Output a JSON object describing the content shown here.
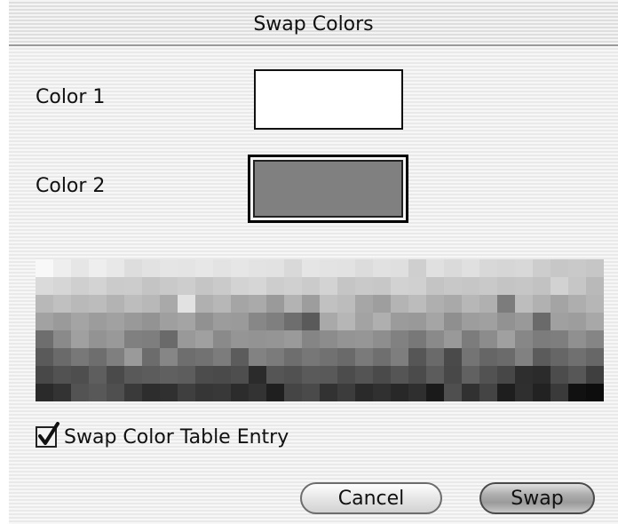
{
  "dialog": {
    "title": "Swap Colors",
    "color1_label": "Color 1",
    "color2_label": "Color 2",
    "color1_value": "#ffffff",
    "color2_value": "#808080",
    "checkbox_label": "Swap Color Table Entry",
    "checkbox_checked": true,
    "cancel_label": "Cancel",
    "swap_label": "Swap"
  },
  "palette": {
    "columns": 32,
    "rows": 8,
    "colors": [
      "#f8f8f8",
      "#eeeeee",
      "#e6e6e6",
      "#eeeeee",
      "#e8e8e8",
      "#dddddd",
      "#e2e2e2",
      "#e5e5e5",
      "#e4e4e4",
      "#e7e7e7",
      "#e3e3e3",
      "#e6e6e6",
      "#e3e3e3",
      "#e2e2e2",
      "#d9d9d9",
      "#e5e5e5",
      "#e3e3e3",
      "#e2e2e2",
      "#dcdcdc",
      "#e1e1e1",
      "#dfdfdf",
      "#cfcfcf",
      "#e0e0e0",
      "#dadada",
      "#e0e0e0",
      "#d8d8d8",
      "#d6d6d6",
      "#d8d8d8",
      "#cdcdcd",
      "#c7c7c7",
      "#c9c9c9",
      "#c6c6c6",
      "#dadada",
      "#d6d6d6",
      "#cfcfcf",
      "#d3d3d3",
      "#cbcbcb",
      "#cccccc",
      "#c4c4c4",
      "#c9c9c9",
      "#cdcdcd",
      "#c5c5c5",
      "#cacaca",
      "#d3d3d3",
      "#d6d6d6",
      "#cdcdcd",
      "#d0d0d0",
      "#cbcbcb",
      "#d3d3d3",
      "#c5c5c5",
      "#c9c9c9",
      "#c7c7c7",
      "#d2d2d2",
      "#d0d0d0",
      "#c4c4c4",
      "#c8c8c8",
      "#c6c6c6",
      "#c9c9c9",
      "#c4c4c4",
      "#c6c6c6",
      "#c2c2c2",
      "#d2d2d2",
      "#c6c6c6",
      "#b9b9b9",
      "#b8b8b8",
      "#c0c0c0",
      "#b9b9b9",
      "#bcbcbc",
      "#b3b3b3",
      "#bdbdbd",
      "#b8b8b8",
      "#a9a9a9",
      "#e2e2e2",
      "#b0b0b0",
      "#b7b7b7",
      "#a5a5a5",
      "#aaaaaa",
      "#9a9a9a",
      "#b3b3b3",
      "#9d9d9d",
      "#c1c1c1",
      "#bcbcbc",
      "#a6a6a6",
      "#9e9e9e",
      "#b4b4b4",
      "#bcbcbc",
      "#afafaf",
      "#a9a9a9",
      "#b7b7b7",
      "#b0b0b0",
      "#7c7c7c",
      "#bdbdbd",
      "#b1b1b1",
      "#a4a4a4",
      "#aeaeae",
      "#b6b6b6",
      "#a2a2a2",
      "#9a9a9a",
      "#a4a4a4",
      "#9c9c9c",
      "#a1a1a1",
      "#999999",
      "#939393",
      "#9f9f9f",
      "#a4a4a4",
      "#919191",
      "#9c9c9c",
      "#9a9a9a",
      "#878787",
      "#7f7f7f",
      "#6e6e6e",
      "#5a5a5a",
      "#a9a9a9",
      "#b6b6b6",
      "#a3a3a3",
      "#afafaf",
      "#9b9b9b",
      "#999999",
      "#a5a5a5",
      "#8f8f8f",
      "#9d9d9d",
      "#a0a0a0",
      "#929292",
      "#999999",
      "#6a6a6a",
      "#a0a0a0",
      "#9d9d9d",
      "#a8a8a8",
      "#6e6e6e",
      "#8a8a8a",
      "#a0a0a0",
      "#939393",
      "#999999",
      "#808080",
      "#7e7e7e",
      "#6a6a6a",
      "#999999",
      "#a0a0a0",
      "#8a8a8a",
      "#959595",
      "#939393",
      "#959595",
      "#9a9a9a",
      "#858585",
      "#8c8c8c",
      "#949494",
      "#969696",
      "#8e8e8e",
      "#818181",
      "#787878",
      "#8a8a8a",
      "#999999",
      "#7c7c7c",
      "#8c8c8c",
      "#a0a0a0",
      "#878787",
      "#7c7c7c",
      "#7e7e7e",
      "#909090",
      "#858585",
      "#5a5a5a",
      "#6a6a6a",
      "#787878",
      "#6e6e6e",
      "#7f7f7f",
      "#9a9a9a",
      "#6c6c6c",
      "#868686",
      "#6e6e6e",
      "#727272",
      "#7c7c7c",
      "#5c5c5c",
      "#828282",
      "#7b7b7b",
      "#6e6e6e",
      "#777777",
      "#717171",
      "#6a6a6a",
      "#7a7a7a",
      "#6f6f6f",
      "#7e7e7e",
      "#565656",
      "#6a6a6a",
      "#4a4a4a",
      "#747474",
      "#666666",
      "#6b6b6b",
      "#818181",
      "#5b5b5b",
      "#666666",
      "#707070",
      "#676767",
      "#484848",
      "#525252",
      "#4e4e4e",
      "#5e5e5e",
      "#4a4a4a",
      "#595959",
      "#5c5c5c",
      "#606060",
      "#5d5d5d",
      "#4c4c4c",
      "#4a4a4a",
      "#4e4e4e",
      "#2b2b2b",
      "#555555",
      "#515151",
      "#5a5a5a",
      "#595959",
      "#4c4c4c",
      "#545454",
      "#4a4a4a",
      "#555555",
      "#4b4b4b",
      "#5c5c5c",
      "#484848",
      "#616161",
      "#525252",
      "#474747",
      "#2e2e2e",
      "#2b2b2b",
      "#4c4c4c",
      "#575757",
      "#3f3f3f",
      "#2a2a2a",
      "#333333",
      "#535353",
      "#585858",
      "#4f4f4f",
      "#3a3a3a",
      "#2d2d2d",
      "#303030",
      "#3f3f3f",
      "#363636",
      "#383838",
      "#2c2c2c",
      "#333333",
      "#1f1f1f",
      "#454545",
      "#4a4a4a",
      "#323232",
      "#3c3c3c",
      "#2a2a2a",
      "#303030",
      "#282828",
      "#2f2f2f",
      "#1a1a1a",
      "#4f4f4f",
      "#313131",
      "#444444",
      "#1e1e1e",
      "#2f2f2f",
      "#222222",
      "#3a3a3a",
      "#111111",
      "#0d0d0d"
    ]
  }
}
